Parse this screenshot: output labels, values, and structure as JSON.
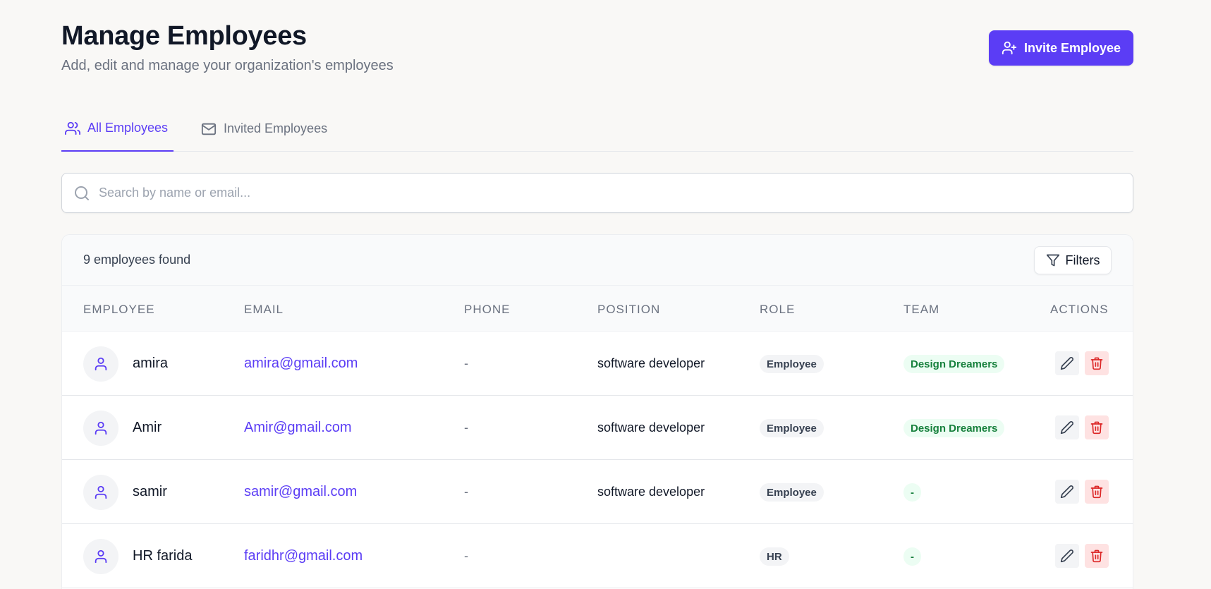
{
  "header": {
    "title": "Manage Employees",
    "subtitle": "Add, edit and manage your organization's employees",
    "invite_label": "Invite Employee"
  },
  "tabs": [
    {
      "label": "All Employees",
      "active": true,
      "icon": "users-icon"
    },
    {
      "label": "Invited Employees",
      "active": false,
      "icon": "mail-icon"
    }
  ],
  "search": {
    "placeholder": "Search by name or email...",
    "value": ""
  },
  "table": {
    "count_text": "9 employees found",
    "filters_label": "Filters",
    "columns": [
      "Employee",
      "Email",
      "Phone",
      "Position",
      "Role",
      "Team",
      "Actions"
    ],
    "rows": [
      {
        "name": "amira",
        "email": "amira@gmail.com",
        "phone": "-",
        "position": "software developer",
        "role": "Employee",
        "team": "Design Dreamers"
      },
      {
        "name": "Amir",
        "email": "Amir@gmail.com",
        "phone": "-",
        "position": "software developer",
        "role": "Employee",
        "team": "Design Dreamers"
      },
      {
        "name": "samir",
        "email": "samir@gmail.com",
        "phone": "-",
        "position": "software developer",
        "role": "Employee",
        "team": "-"
      },
      {
        "name": "HR farida",
        "email": "faridhr@gmail.com",
        "phone": "-",
        "position": "",
        "role": "HR",
        "team": "-"
      }
    ]
  },
  "colors": {
    "accent": "#5b3df5",
    "team_text": "#16803c",
    "delete": "#dc2626"
  }
}
